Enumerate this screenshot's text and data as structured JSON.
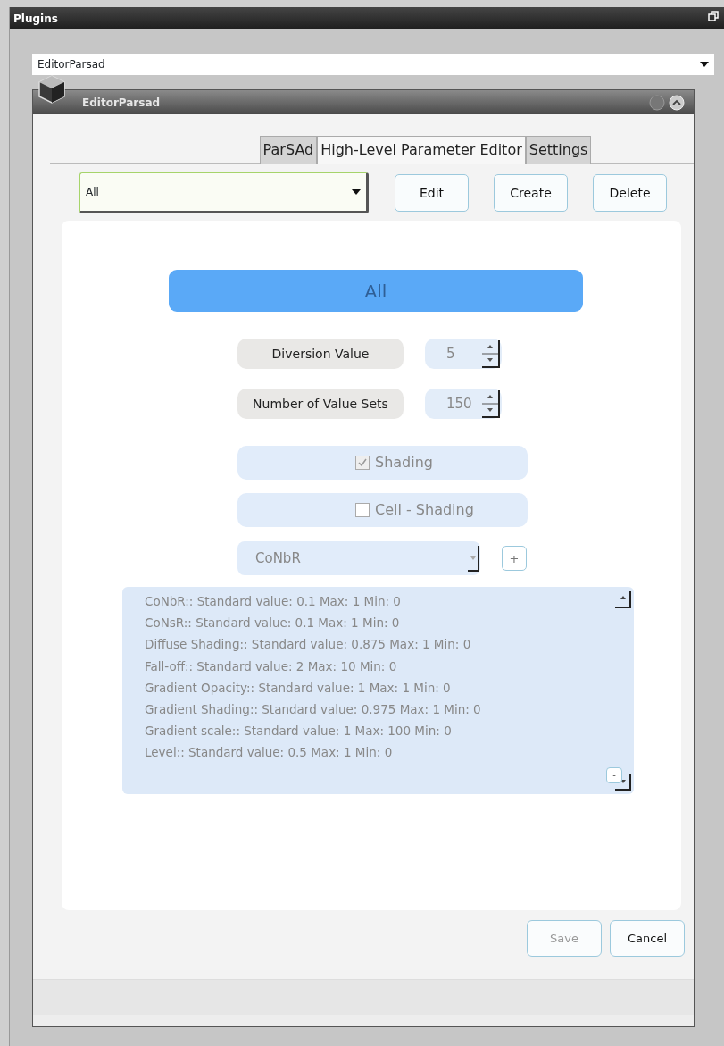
{
  "panel": {
    "title": "Plugins"
  },
  "plugin_select": {
    "value": "EditorParsad"
  },
  "window": {
    "title": "EditorParsad"
  },
  "tabs": [
    {
      "label": "ParSAd",
      "selected": false
    },
    {
      "label": "High-Level Parameter Editor",
      "selected": true
    },
    {
      "label": "Settings",
      "selected": false
    }
  ],
  "filter_select": {
    "value": "All"
  },
  "toolbar_buttons": [
    "Edit",
    "Create",
    "Delete"
  ],
  "banner": "All",
  "spinners": [
    {
      "label": "Diversion Value",
      "value": "5"
    },
    {
      "label": "Number of Value Sets",
      "value": "150"
    }
  ],
  "checkboxes": [
    {
      "label": "Shading",
      "checked": true
    },
    {
      "label": "Cell - Shading",
      "checked": false
    }
  ],
  "parameter_select": {
    "value": "CoNbR"
  },
  "add_button": "+",
  "parameters": [
    "CoNbR:: Standard value: 0.1 Max: 1 Min: 0",
    "CoNsR:: Standard value: 0.1 Max: 1 Min: 0",
    "Diffuse Shading:: Standard value: 0.875 Max: 1 Min: 0",
    "Fall-off:: Standard value: 2 Max: 10 Min: 0",
    "Gradient Opacity:: Standard value: 1 Max: 1 Min: 0",
    "Gradient Shading:: Standard value: 0.975 Max: 1 Min: 0",
    "Gradient scale:: Standard value: 1 Max: 100 Min: 0",
    "Level:: Standard value: 0.5 Max: 1 Min: 0"
  ],
  "list_button": "-",
  "footer_buttons": [
    {
      "label": "Save",
      "disabled": true
    },
    {
      "label": "Cancel",
      "disabled": false
    }
  ]
}
